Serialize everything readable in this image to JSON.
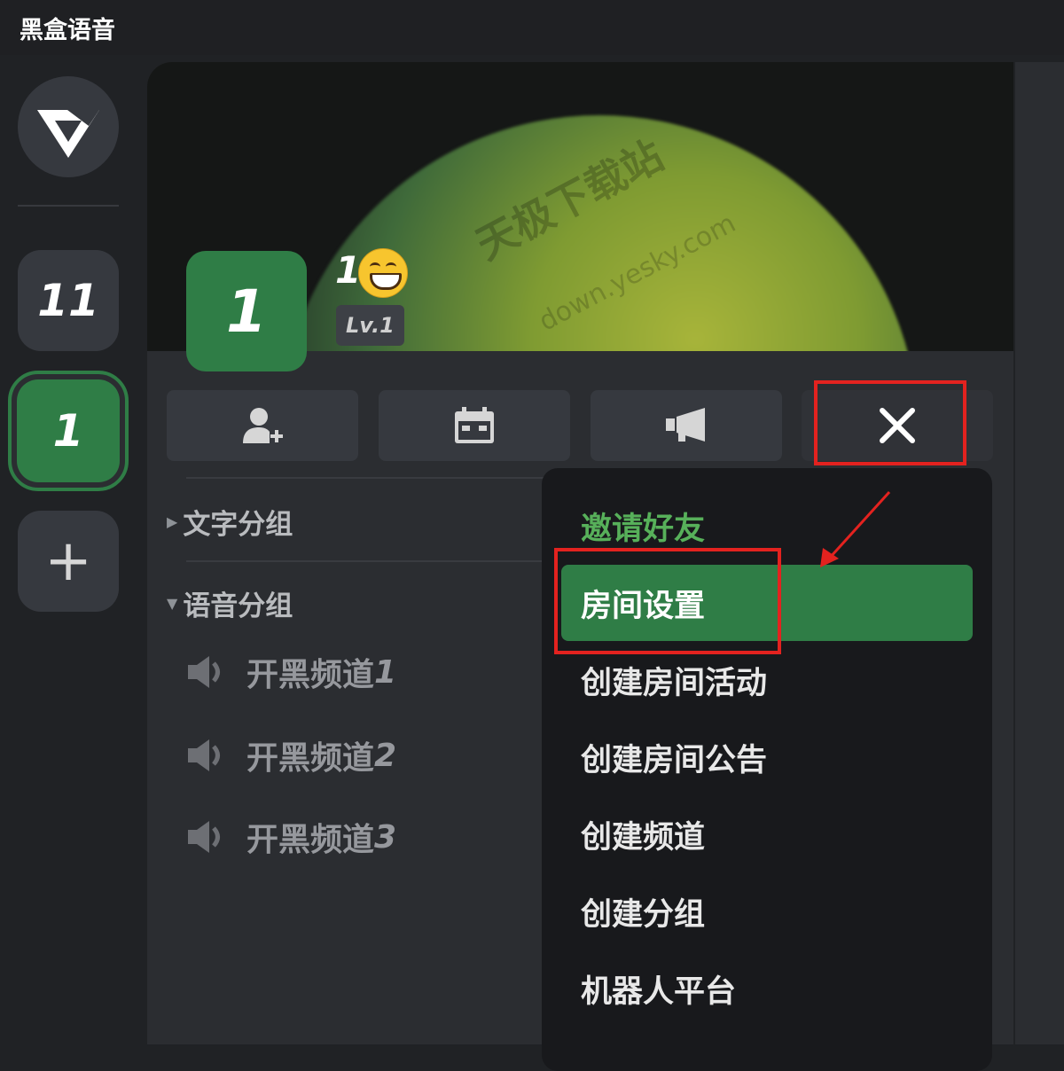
{
  "app": {
    "title": "黑盒语音"
  },
  "rail": {
    "servers": [
      {
        "label": "11"
      },
      {
        "label": "1",
        "selected": true
      }
    ],
    "add_label": "+"
  },
  "room": {
    "avatar_label": "1",
    "name": "1",
    "level": "Lv.1"
  },
  "watermark": {
    "line1": "天极下载站",
    "line2": "down.yesky.com"
  },
  "toolbar": {
    "buttons": [
      {
        "icon": "add-user-icon"
      },
      {
        "icon": "calendar-icon"
      },
      {
        "icon": "megaphone-icon"
      },
      {
        "icon": "close-icon"
      }
    ]
  },
  "groups": {
    "text_group": "文字分组",
    "voice_group": "语音分组",
    "channels": [
      {
        "name": "开黑频道",
        "num": "1"
      },
      {
        "name": "开黑频道",
        "num": "2"
      },
      {
        "name": "开黑频道",
        "num": "3"
      }
    ]
  },
  "menu": {
    "items": [
      {
        "label": "邀请好友"
      },
      {
        "label": "房间设置",
        "active": true
      },
      {
        "label": "创建房间活动"
      },
      {
        "label": "创建房间公告"
      },
      {
        "label": "创建频道"
      },
      {
        "label": "创建分组"
      },
      {
        "label": "机器人平台"
      }
    ]
  },
  "colors": {
    "accent_green": "#2f7d46",
    "invite_green": "#57b05a",
    "annotation_red": "#e3221f"
  }
}
